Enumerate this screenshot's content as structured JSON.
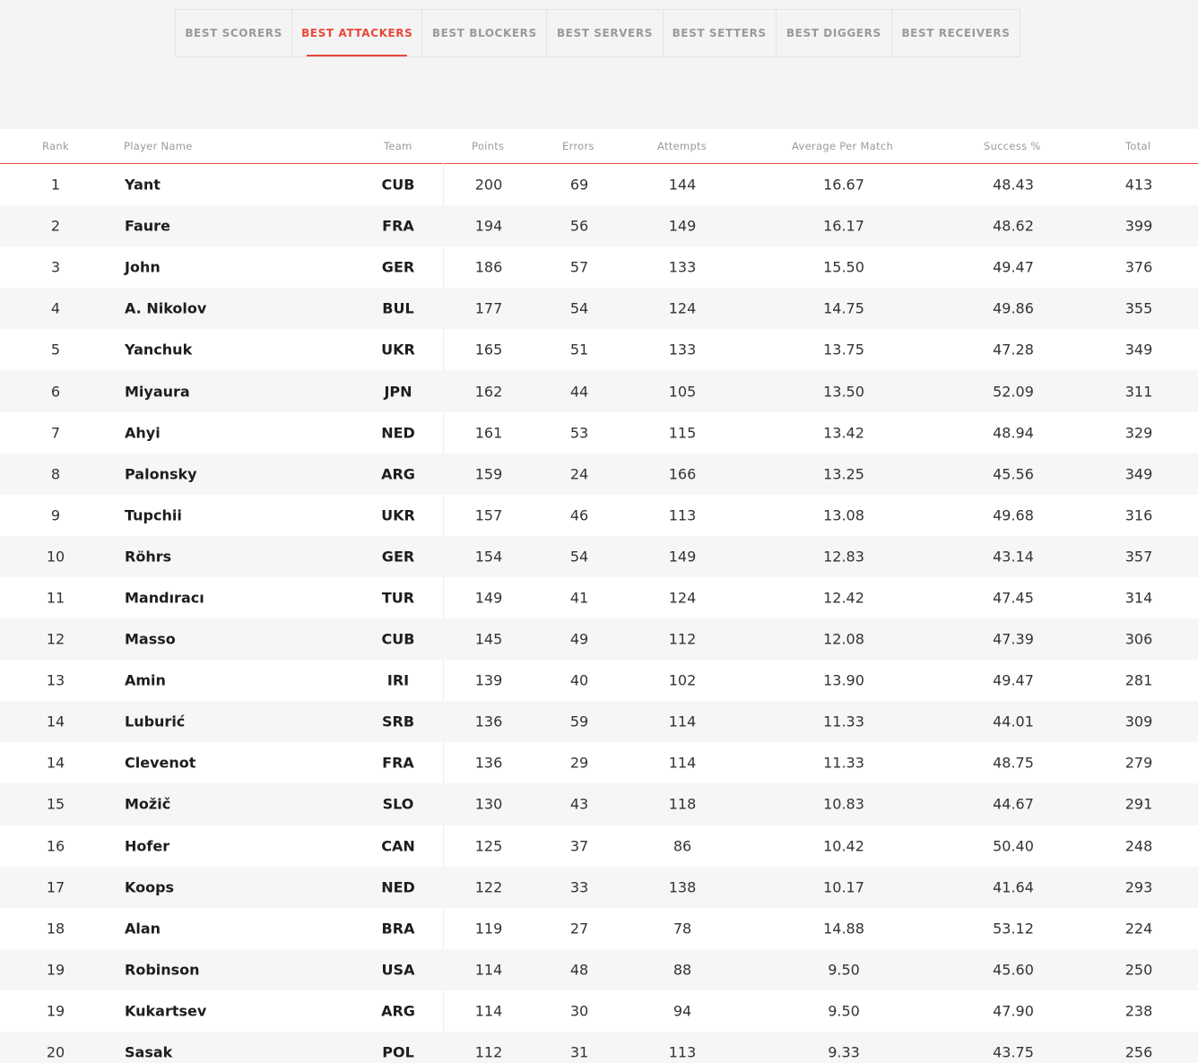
{
  "tabs": [
    {
      "label": "BEST SCORERS",
      "width": 130,
      "active": false
    },
    {
      "label": "BEST ATTACKERS",
      "width": 145,
      "active": true
    },
    {
      "label": "BEST BLOCKERS",
      "width": 139,
      "active": false
    },
    {
      "label": "BEST SERVERS",
      "width": 129,
      "active": false
    },
    {
      "label": "BEST SETTERS",
      "width": 126,
      "active": false
    },
    {
      "label": "BEST DIGGERS",
      "width": 129,
      "active": false
    },
    {
      "label": "BEST RECEIVERS",
      "width": 143,
      "active": false
    }
  ],
  "table": {
    "headers": {
      "rank": "Rank",
      "name": "Player Name",
      "team": "Team",
      "points": "Points",
      "errors": "Errors",
      "attempts": "Attempts",
      "avg": "Average Per Match",
      "success": "Success %",
      "total": "Total"
    },
    "rows": [
      {
        "rank": "1",
        "name": "Yant",
        "team": "CUB",
        "points": "200",
        "errors": "69",
        "attempts": "144",
        "avg": "16.67",
        "success": "48.43",
        "total": "413"
      },
      {
        "rank": "2",
        "name": "Faure",
        "team": "FRA",
        "points": "194",
        "errors": "56",
        "attempts": "149",
        "avg": "16.17",
        "success": "48.62",
        "total": "399"
      },
      {
        "rank": "3",
        "name": "John",
        "team": "GER",
        "points": "186",
        "errors": "57",
        "attempts": "133",
        "avg": "15.50",
        "success": "49.47",
        "total": "376"
      },
      {
        "rank": "4",
        "name": "A. Nikolov",
        "team": "BUL",
        "points": "177",
        "errors": "54",
        "attempts": "124",
        "avg": "14.75",
        "success": "49.86",
        "total": "355"
      },
      {
        "rank": "5",
        "name": "Yanchuk",
        "team": "UKR",
        "points": "165",
        "errors": "51",
        "attempts": "133",
        "avg": "13.75",
        "success": "47.28",
        "total": "349"
      },
      {
        "rank": "6",
        "name": "Miyaura",
        "team": "JPN",
        "points": "162",
        "errors": "44",
        "attempts": "105",
        "avg": "13.50",
        "success": "52.09",
        "total": "311"
      },
      {
        "rank": "7",
        "name": "Ahyi",
        "team": "NED",
        "points": "161",
        "errors": "53",
        "attempts": "115",
        "avg": "13.42",
        "success": "48.94",
        "total": "329"
      },
      {
        "rank": "8",
        "name": "Palonsky",
        "team": "ARG",
        "points": "159",
        "errors": "24",
        "attempts": "166",
        "avg": "13.25",
        "success": "45.56",
        "total": "349"
      },
      {
        "rank": "9",
        "name": "Tupchii",
        "team": "UKR",
        "points": "157",
        "errors": "46",
        "attempts": "113",
        "avg": "13.08",
        "success": "49.68",
        "total": "316"
      },
      {
        "rank": "10",
        "name": "Röhrs",
        "team": "GER",
        "points": "154",
        "errors": "54",
        "attempts": "149",
        "avg": "12.83",
        "success": "43.14",
        "total": "357"
      },
      {
        "rank": "11",
        "name": "Mandıracı",
        "team": "TUR",
        "points": "149",
        "errors": "41",
        "attempts": "124",
        "avg": "12.42",
        "success": "47.45",
        "total": "314"
      },
      {
        "rank": "12",
        "name": "Masso",
        "team": "CUB",
        "points": "145",
        "errors": "49",
        "attempts": "112",
        "avg": "12.08",
        "success": "47.39",
        "total": "306"
      },
      {
        "rank": "13",
        "name": "Amin",
        "team": "IRI",
        "points": "139",
        "errors": "40",
        "attempts": "102",
        "avg": "13.90",
        "success": "49.47",
        "total": "281"
      },
      {
        "rank": "14",
        "name": "Luburić",
        "team": "SRB",
        "points": "136",
        "errors": "59",
        "attempts": "114",
        "avg": "11.33",
        "success": "44.01",
        "total": "309"
      },
      {
        "rank": "14",
        "name": "Clevenot",
        "team": "FRA",
        "points": "136",
        "errors": "29",
        "attempts": "114",
        "avg": "11.33",
        "success": "48.75",
        "total": "279"
      },
      {
        "rank": "15",
        "name": "Možič",
        "team": "SLO",
        "points": "130",
        "errors": "43",
        "attempts": "118",
        "avg": "10.83",
        "success": "44.67",
        "total": "291"
      },
      {
        "rank": "16",
        "name": "Hofer",
        "team": "CAN",
        "points": "125",
        "errors": "37",
        "attempts": "86",
        "avg": "10.42",
        "success": "50.40",
        "total": "248"
      },
      {
        "rank": "17",
        "name": "Koops",
        "team": "NED",
        "points": "122",
        "errors": "33",
        "attempts": "138",
        "avg": "10.17",
        "success": "41.64",
        "total": "293"
      },
      {
        "rank": "18",
        "name": "Alan",
        "team": "BRA",
        "points": "119",
        "errors": "27",
        "attempts": "78",
        "avg": "14.88",
        "success": "53.12",
        "total": "224"
      },
      {
        "rank": "19",
        "name": "Robinson",
        "team": "USA",
        "points": "114",
        "errors": "48",
        "attempts": "88",
        "avg": "9.50",
        "success": "45.60",
        "total": "250"
      },
      {
        "rank": "19",
        "name": "Kukartsev",
        "team": "ARG",
        "points": "114",
        "errors": "30",
        "attempts": "94",
        "avg": "9.50",
        "success": "47.90",
        "total": "238"
      },
      {
        "rank": "20",
        "name": "Sasak",
        "team": "POL",
        "points": "112",
        "errors": "31",
        "attempts": "113",
        "avg": "9.33",
        "success": "43.75",
        "total": "256"
      }
    ]
  }
}
